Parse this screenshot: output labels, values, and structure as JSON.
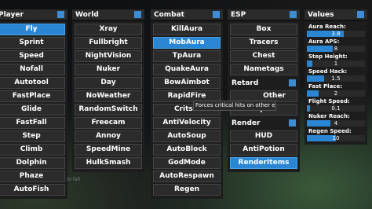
{
  "columns": {
    "player": {
      "title": "Player",
      "items": [
        "Fly",
        "Sprint",
        "Speed",
        "Nofall",
        "Autotool",
        "FastPlace",
        "Glide",
        "FastFall",
        "Step",
        "Climb",
        "Dolphin",
        "Phaze",
        "AutoFish"
      ]
    },
    "world": {
      "title": "World",
      "items": [
        "Xray",
        "Fullbright",
        "NightVision",
        "Nuker",
        "Day",
        "NoWeather",
        "RandomSwitch",
        "Freecam",
        "Annoy",
        "SpeedMine",
        "HulkSmash"
      ]
    },
    "combat": {
      "title": "Combat",
      "items": [
        "KillAura",
        "MobAura",
        "TpAura",
        "QuakeAura",
        "BowAimbot",
        "RapidFire",
        "Crits",
        "AntiVelocity",
        "AutoSoup",
        "AutoBlock",
        "GodMode",
        "AutoRespawn",
        "Regen"
      ]
    },
    "esp": {
      "title": "ESP",
      "items": [
        "Box",
        "Tracers",
        "Chest",
        "Nametags"
      ],
      "retard_title": "Retard",
      "retard_items": [
        "Other",
        "Spin"
      ],
      "render_title": "Render",
      "render_items": [
        "HUD",
        "AntiPotion",
        "RenderItems"
      ]
    },
    "values": {
      "title": "Values",
      "items": [
        {
          "label": "Aura Reach:",
          "value": "3.8",
          "fill": 0.63
        },
        {
          "label": "Aura APS:",
          "value": "8",
          "fill": 0.45
        },
        {
          "label": "Step Height:",
          "value": "1",
          "fill": 0.1
        },
        {
          "label": "Speed Hack:",
          "value": "1.5",
          "fill": 0.3
        },
        {
          "label": "Fast Place:",
          "value": "2",
          "fill": 0.2
        },
        {
          "label": "Flight Speed:",
          "value": "0.1",
          "fill": 0.05
        },
        {
          "label": "Nuker Reach:",
          "value": "4",
          "fill": 0.4
        },
        {
          "label": "Regen Speed:",
          "value": "10",
          "fill": 0.5
        }
      ]
    }
  },
  "active": [
    "Fly",
    "MobAura",
    "RenderItems"
  ],
  "tooltip": "Forces critical hits on other entities",
  "chat_text": "to fall",
  "colors": {
    "accent": "#2a86d2",
    "header": "#2b2b2b",
    "panel": "#1d1d1d"
  }
}
